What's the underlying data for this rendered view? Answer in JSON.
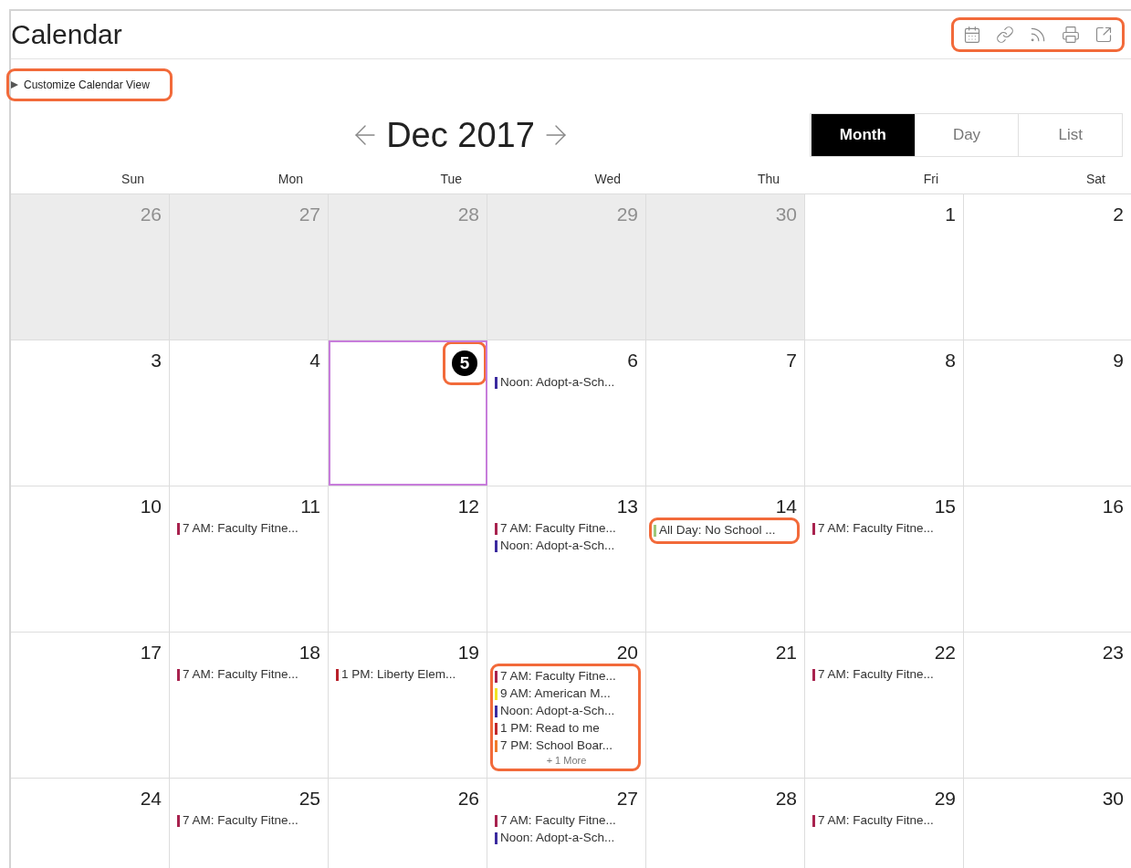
{
  "title": "Calendar",
  "toolbar": {
    "callout": true,
    "icons": [
      {
        "kind": "calendar"
      },
      {
        "kind": "link"
      },
      {
        "kind": "rss"
      },
      {
        "kind": "print"
      },
      {
        "kind": "external"
      }
    ]
  },
  "customize": {
    "label": "Customize Calendar View",
    "expanded": false,
    "callout": true
  },
  "month_label": "Dec 2017",
  "views": [
    {
      "label": "Month",
      "selected": true
    },
    {
      "label": "Day",
      "selected": false
    },
    {
      "label": "List",
      "selected": false
    }
  ],
  "weekdays": [
    "Sun",
    "Mon",
    "Tue",
    "Wed",
    "Thu",
    "Fri",
    "Sat"
  ],
  "weeks": [
    {
      "days": [
        {
          "date": "26",
          "outside": true,
          "today": false
        },
        {
          "date": "27",
          "outside": true,
          "today": false
        },
        {
          "date": "28",
          "outside": true,
          "today": false
        },
        {
          "date": "29",
          "outside": true,
          "today": false
        },
        {
          "date": "30",
          "outside": true,
          "today": false
        },
        {
          "date": "1",
          "outside": false,
          "today": false
        },
        {
          "date": "2",
          "outside": false,
          "today": false
        }
      ]
    },
    {
      "days": [
        {
          "date": "3",
          "outside": false,
          "today": false
        },
        {
          "date": "4",
          "outside": false,
          "today": false
        },
        {
          "date": "5",
          "outside": false,
          "today": true,
          "callout": true
        },
        {
          "date": "6",
          "outside": false,
          "today": false,
          "events": [
            {
              "text": "Noon: Adopt-a-Sch...",
              "color": "#3b2a9e"
            }
          ]
        },
        {
          "date": "7",
          "outside": false,
          "today": false
        },
        {
          "date": "8",
          "outside": false,
          "today": false
        },
        {
          "date": "9",
          "outside": false,
          "today": false
        }
      ]
    },
    {
      "days": [
        {
          "date": "10",
          "outside": false,
          "today": false
        },
        {
          "date": "11",
          "outside": false,
          "today": false,
          "events": [
            {
              "text": "7 AM: Faculty Fitne...",
              "color": "#a8224e"
            }
          ]
        },
        {
          "date": "12",
          "outside": false,
          "today": false
        },
        {
          "date": "13",
          "outside": false,
          "today": false,
          "events": [
            {
              "text": "7 AM: Faculty Fitne...",
              "color": "#a8224e"
            },
            {
              "text": "Noon: Adopt-a-Sch...",
              "color": "#3b2a9e"
            }
          ]
        },
        {
          "date": "14",
          "outside": false,
          "today": false,
          "events_callout": true,
          "events": [
            {
              "text": "All Day: No School ...",
              "color": "#9cc87a"
            }
          ]
        },
        {
          "date": "15",
          "outside": false,
          "today": false,
          "events": [
            {
              "text": "7 AM: Faculty Fitne...",
              "color": "#a8224e"
            }
          ]
        },
        {
          "date": "16",
          "outside": false,
          "today": false
        }
      ]
    },
    {
      "days": [
        {
          "date": "17",
          "outside": false,
          "today": false
        },
        {
          "date": "18",
          "outside": false,
          "today": false,
          "events": [
            {
              "text": "7 AM: Faculty Fitne...",
              "color": "#a8224e"
            }
          ]
        },
        {
          "date": "19",
          "outside": false,
          "today": false,
          "events": [
            {
              "text": "1 PM: Liberty Elem...",
              "color": "#b8202a"
            }
          ]
        },
        {
          "date": "20",
          "outside": false,
          "today": false,
          "events_callout": true,
          "more": "+ 1 More",
          "events": [
            {
              "text": "7 AM: Faculty Fitne...",
              "color": "#a8224e"
            },
            {
              "text": "9 AM: American M...",
              "color": "#f0e224"
            },
            {
              "text": "Noon: Adopt-a-Sch...",
              "color": "#3b2a9e"
            },
            {
              "text": "1 PM: Read to me",
              "color": "#c0282a"
            },
            {
              "text": "7 PM: School Boar...",
              "color": "#f07a2a"
            }
          ]
        },
        {
          "date": "21",
          "outside": false,
          "today": false
        },
        {
          "date": "22",
          "outside": false,
          "today": false,
          "events": [
            {
              "text": "7 AM: Faculty Fitne...",
              "color": "#a8224e"
            }
          ]
        },
        {
          "date": "23",
          "outside": false,
          "today": false
        }
      ]
    },
    {
      "days": [
        {
          "date": "24",
          "outside": false,
          "today": false
        },
        {
          "date": "25",
          "outside": false,
          "today": false,
          "events": [
            {
              "text": "7 AM: Faculty Fitne...",
              "color": "#a8224e"
            }
          ]
        },
        {
          "date": "26",
          "outside": false,
          "today": false
        },
        {
          "date": "27",
          "outside": false,
          "today": false,
          "events": [
            {
              "text": "7 AM: Faculty Fitne...",
              "color": "#a8224e"
            },
            {
              "text": "Noon: Adopt-a-Sch...",
              "color": "#3b2a9e"
            }
          ]
        },
        {
          "date": "28",
          "outside": false,
          "today": false
        },
        {
          "date": "29",
          "outside": false,
          "today": false,
          "events": [
            {
              "text": "7 AM: Faculty Fitne...",
              "color": "#a8224e"
            }
          ]
        },
        {
          "date": "30",
          "outside": false,
          "today": false
        }
      ]
    }
  ]
}
